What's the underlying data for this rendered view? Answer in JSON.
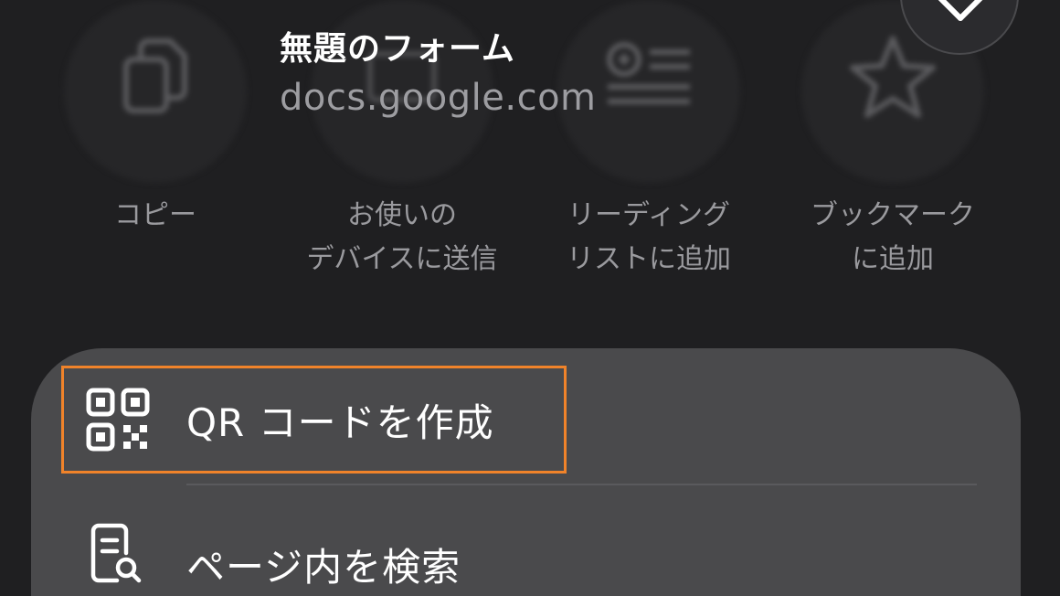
{
  "header": {
    "title": "無題のフォーム",
    "url": "docs.google.com"
  },
  "actions": [
    {
      "label": "コピー",
      "icon": "copy-icon"
    },
    {
      "label": "お使いの\nデバイスに送信",
      "icon": "send-to-device-icon"
    },
    {
      "label": "リーディング\nリストに追加",
      "icon": "reading-list-icon"
    },
    {
      "label": "ブックマーク\nに追加",
      "icon": "star-icon"
    }
  ],
  "menu": {
    "items": [
      {
        "label": "QR コードを作成",
        "icon": "qr-code-icon"
      },
      {
        "label": "ページ内を検索",
        "icon": "find-in-page-icon"
      }
    ]
  },
  "colors": {
    "background": "#1f1f21",
    "sheet": "#4a4a4c",
    "highlight": "#f0832a"
  }
}
